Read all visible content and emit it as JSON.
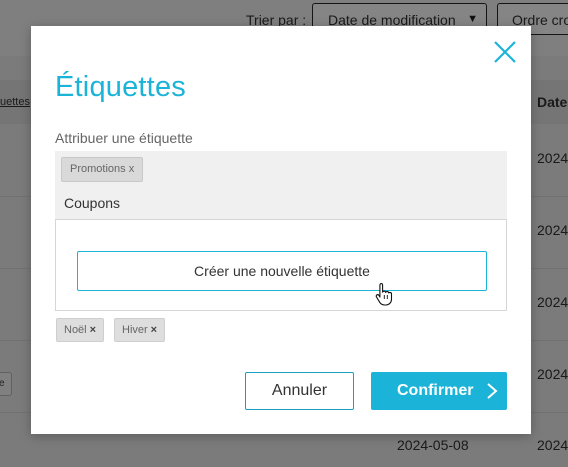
{
  "background": {
    "sort_label": "Trier par :",
    "sort_select_value": "Date de modification",
    "sort_order_label": "Ordre cro",
    "table_header_left": "uettes",
    "table_header_date": "Date",
    "row_dates": [
      "2024",
      "2024",
      "2024",
      "2024",
      "2024",
      "2024"
    ],
    "bottom_date": "2024-05-08",
    "left_chip": "e"
  },
  "modal": {
    "title": "Étiquettes",
    "assign_label": "Attribuer une étiquette",
    "selected_tags": [
      "Promotions x"
    ],
    "input_value": "Coupons",
    "create_button_label": "Créer une nouvelle étiquette",
    "suggested_tags": [
      {
        "label": "Noël",
        "remove": "×"
      },
      {
        "label": "Hiver",
        "remove": "×"
      }
    ],
    "cancel_label": "Annuler",
    "confirm_label": "Confirmer"
  },
  "colors": {
    "accent": "#1bb4d8",
    "overlay": "rgba(0,0,0,0.48)"
  },
  "icons": [
    "close-icon",
    "chevron-down-icon",
    "chevron-right-icon",
    "hand-cursor-icon"
  ]
}
